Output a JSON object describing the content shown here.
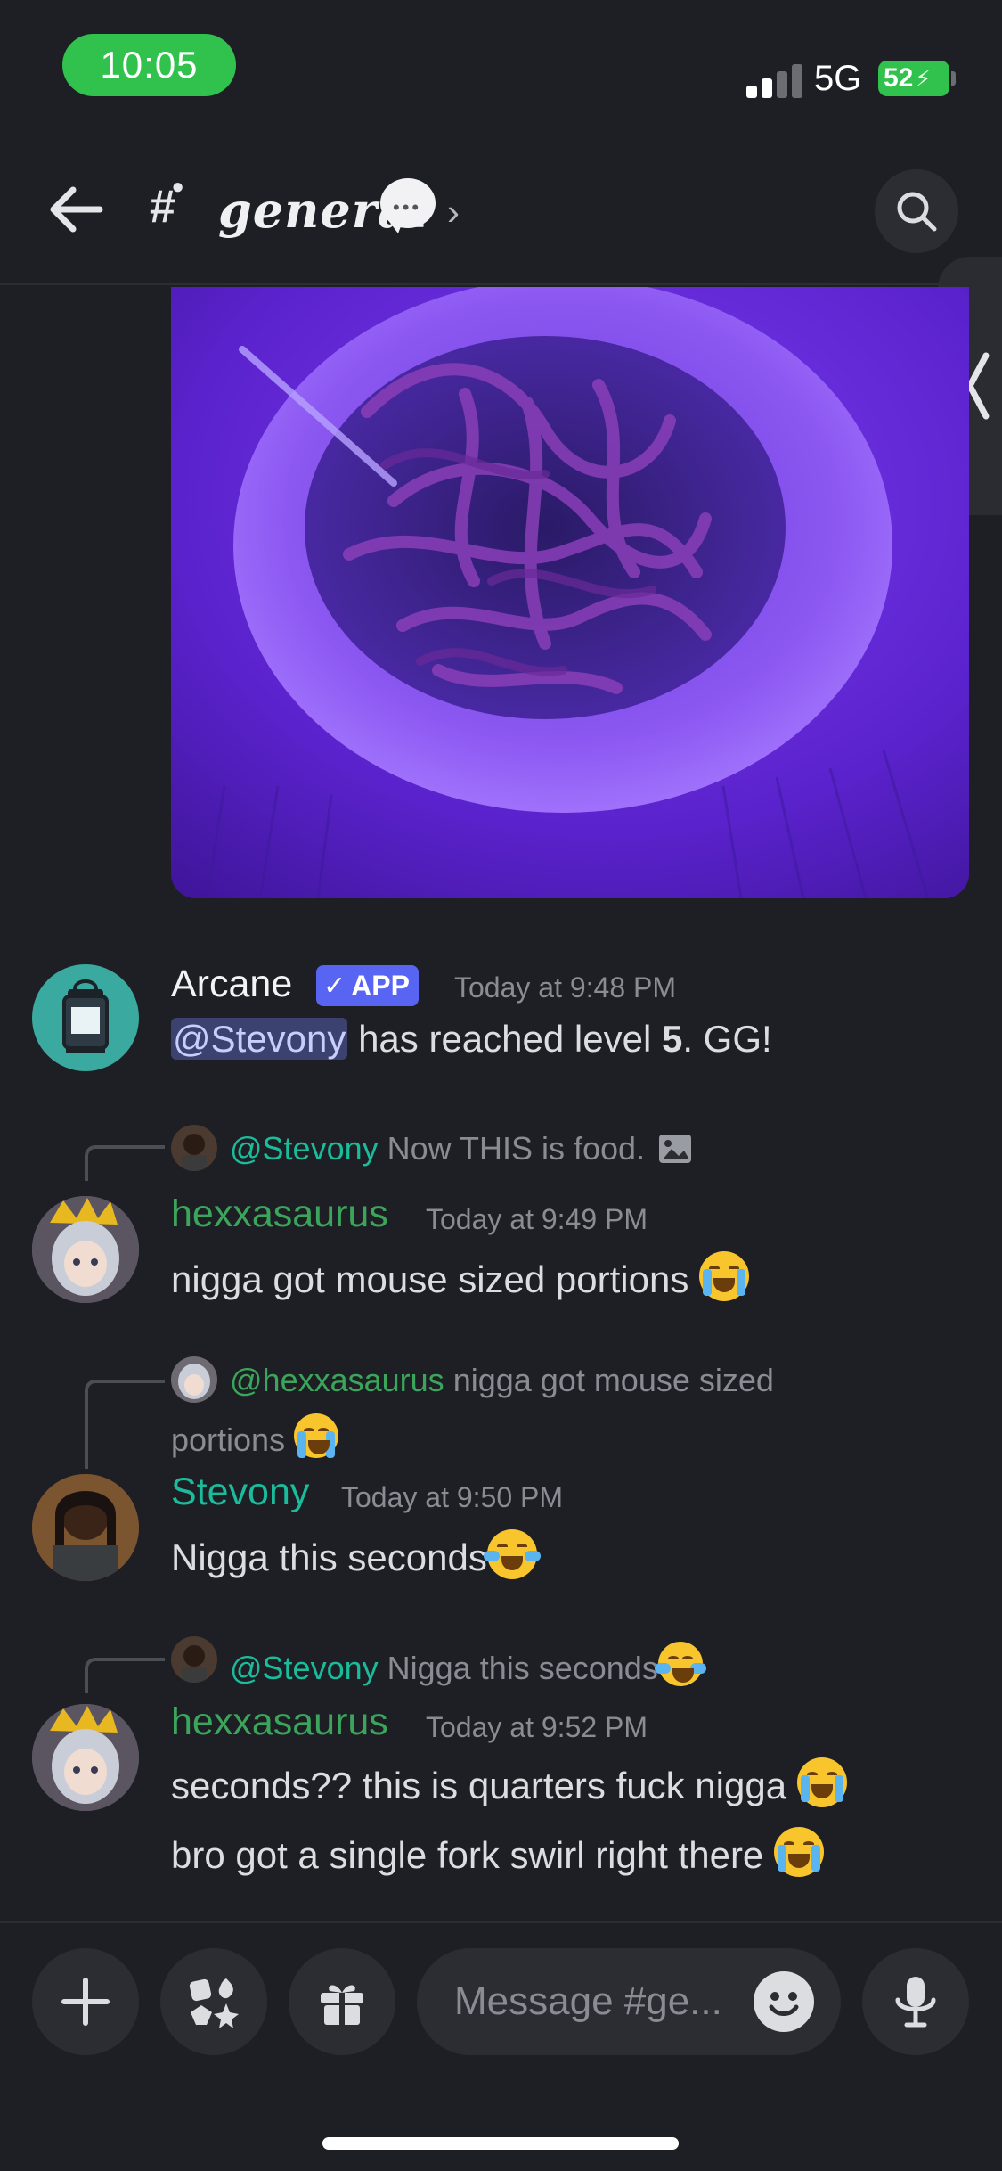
{
  "status_bar": {
    "time": "10:05",
    "network": "5G",
    "battery": "52",
    "colors": {
      "time_pill": "#30c24d",
      "battery": "#30c24d"
    }
  },
  "header": {
    "channel_name": "general",
    "icons": [
      "back-arrow-icon",
      "channel-hash-icon",
      "speech-bubble-icon",
      "chevron-right-icon",
      "search-icon"
    ]
  },
  "messages": [
    {
      "author": "Arcane",
      "author_color": "#f2f3f5",
      "badge": "APP",
      "time": "Today at 9:48 PM",
      "mention": "@Stevony",
      "text_mid": " has reached level ",
      "level": "5",
      "text_end": ". GG!"
    },
    {
      "reply_to": "@Stevony",
      "reply_text": "Now THIS is food.",
      "author": "hexxasaurus",
      "author_color": "#3ba55c",
      "time": "Today at 9:49 PM",
      "lines": [
        "nigga got mouse sized portions"
      ]
    },
    {
      "reply_to": "@hexxasaurus",
      "reply_text_1": "nigga got mouse sized",
      "reply_text_2": "portions",
      "author": "Stevony",
      "author_color": "#1abc9c",
      "time": "Today at 9:50 PM",
      "lines": [
        "Nigga this seconds"
      ]
    },
    {
      "reply_to": "@Stevony",
      "reply_text": "Nigga this seconds",
      "author": "hexxasaurus",
      "author_color": "#3ba55c",
      "time": "Today at 9:52 PM",
      "lines": [
        "seconds?? this is quarters fuck nigga",
        "bro got a single fork swirl right there"
      ]
    }
  ],
  "composer": {
    "placeholder": "Message #ge...",
    "icons": [
      "plus-icon",
      "apps-icon",
      "gift-icon",
      "emoji-icon",
      "microphone-icon"
    ]
  }
}
